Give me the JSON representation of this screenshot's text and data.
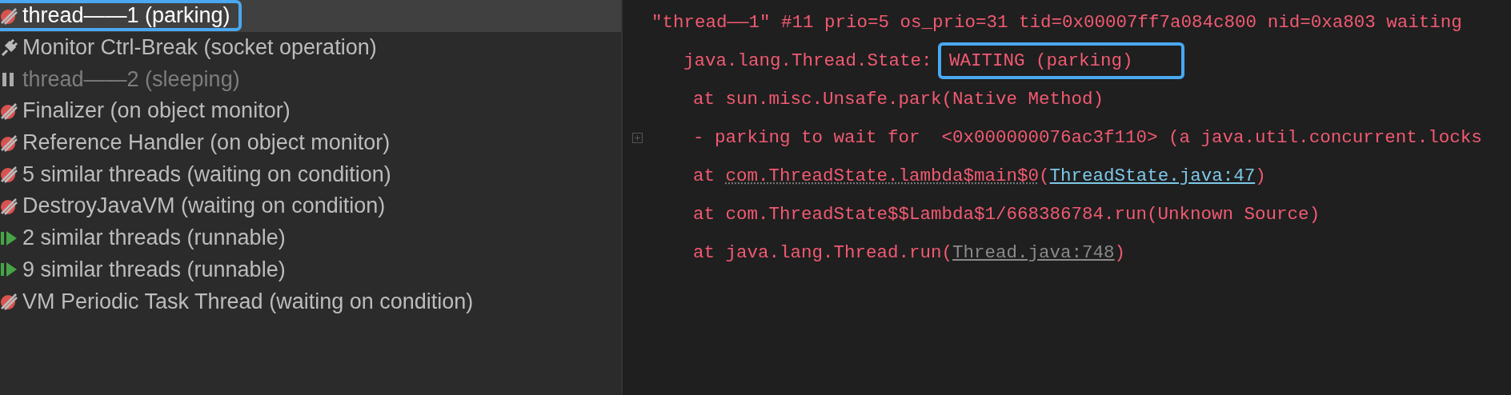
{
  "threads": [
    {
      "name": "thread——1 (parking)",
      "kind": "parked",
      "selected": true
    },
    {
      "name": "Monitor Ctrl-Break (socket operation)",
      "kind": "socket",
      "selected": false
    },
    {
      "name": "thread——2 (sleeping)",
      "kind": "sleeping",
      "selected": false
    },
    {
      "name": "Finalizer (on object monitor)",
      "kind": "parked",
      "selected": false
    },
    {
      "name": "Reference Handler (on object monitor)",
      "kind": "parked",
      "selected": false
    },
    {
      "name": "5 similar threads (waiting on condition)",
      "kind": "parked",
      "selected": false
    },
    {
      "name": "DestroyJavaVM (waiting on condition)",
      "kind": "parked",
      "selected": false
    },
    {
      "name": "2 similar threads (runnable)",
      "kind": "running",
      "selected": false
    },
    {
      "name": "9 similar threads (runnable)",
      "kind": "running",
      "selected": false
    },
    {
      "name": "VM Periodic Task Thread (waiting on condition)",
      "kind": "parked",
      "selected": false
    }
  ],
  "dump": [
    {
      "kind": "header",
      "expandable": false,
      "segments": [
        {
          "kind": "plain",
          "text": "\"thread——1\" #11 prio=5 os_prio=31 tid=0x00007ff7a084c800 nid=0xa803 waiting"
        }
      ]
    },
    {
      "kind": "state",
      "expandable": false,
      "segments": [
        {
          "kind": "plain",
          "text": "java.lang.Thread.State: "
        },
        {
          "kind": "boxed",
          "text": "WAITING (parking)"
        }
      ]
    },
    {
      "kind": "frame",
      "expandable": false,
      "segments": [
        {
          "kind": "plain",
          "text": "at sun.misc.Unsafe.park(Native Method)"
        }
      ]
    },
    {
      "kind": "frame",
      "expandable": true,
      "segments": [
        {
          "kind": "plain",
          "text": "- parking to wait for  <0x000000076ac3f110> (a java.util.concurrent.locks"
        }
      ]
    },
    {
      "kind": "frame",
      "expandable": false,
      "segments": [
        {
          "kind": "plain",
          "text": "at "
        },
        {
          "kind": "dotted",
          "text": "com.ThreadState.lambda$main$0"
        },
        {
          "kind": "plain",
          "text": "("
        },
        {
          "kind": "link",
          "text": "ThreadState.java:47"
        },
        {
          "kind": "plain",
          "text": ")"
        }
      ]
    },
    {
      "kind": "frame",
      "expandable": false,
      "segments": [
        {
          "kind": "plain",
          "text": "at com.ThreadState$$Lambda$1/668386784.run(Unknown Source)"
        }
      ]
    },
    {
      "kind": "frame",
      "expandable": false,
      "segments": [
        {
          "kind": "plain",
          "text": "at java.lang.Thread.run("
        },
        {
          "kind": "library_link",
          "text": "Thread.java:748"
        },
        {
          "kind": "plain",
          "text": ")"
        }
      ]
    }
  ]
}
